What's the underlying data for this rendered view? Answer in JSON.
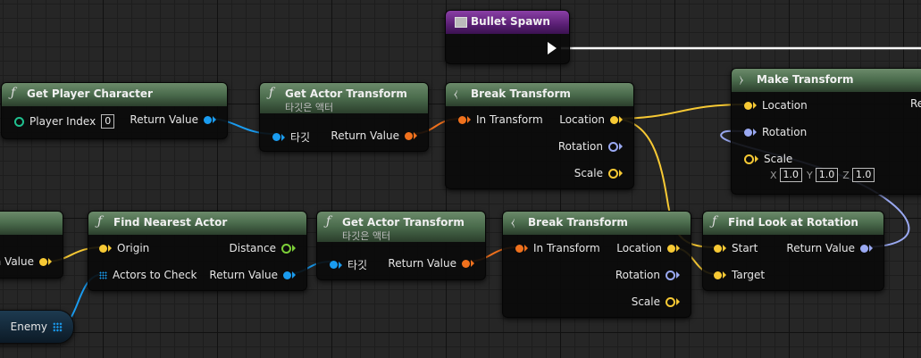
{
  "colors": {
    "exec": "#ffffff",
    "object": "#1a9cf0",
    "vector": "#f7c934",
    "rotator": "#9aa9f2",
    "transform": "#f0711d",
    "int": "#20c08f",
    "bool": "#9e1a1a"
  },
  "bullet_spawn": {
    "title": "Bullet Spawn"
  },
  "get_player_character": {
    "title": "Get Player Character",
    "player_index_label": "Player Index",
    "player_index_value": "0",
    "return_value": "Return Value"
  },
  "get_actor_transform_1": {
    "title": "Get Actor Transform",
    "subtitle": "타깃은 액터",
    "target": "타깃",
    "return_value": "Return Value"
  },
  "break_transform_1": {
    "title": "Break Transform",
    "in": "In Transform",
    "location": "Location",
    "rotation": "Rotation",
    "scale": "Scale"
  },
  "make_transform": {
    "title": "Make Transform",
    "location": "Location",
    "rotation": "Rotation",
    "scale": "Scale",
    "x_label": "X",
    "x": "1.0",
    "y_label": "Y",
    "y": "1.0",
    "z_label": "Z",
    "z": "1.0",
    "return_cut": "Re"
  },
  "enemy_partial": {
    "return_value": "n Value"
  },
  "find_nearest_actor": {
    "title": "Find Nearest Actor",
    "origin": "Origin",
    "actors_to_check": "Actors to Check",
    "distance": "Distance",
    "return_value": "Return Value"
  },
  "get_actor_transform_2": {
    "title": "Get Actor Transform",
    "subtitle": "타깃은 액터",
    "target": "타깃",
    "return_value": "Return Value"
  },
  "break_transform_2": {
    "title": "Break Transform",
    "in": "In Transform",
    "location": "Location",
    "rotation": "Rotation",
    "scale": "Scale"
  },
  "find_look_at_rotation": {
    "title": "Find Look at Rotation",
    "start": "Start",
    "target": "Target",
    "return_value": "Return Value"
  },
  "enemy_var": {
    "label": "Enemy"
  }
}
